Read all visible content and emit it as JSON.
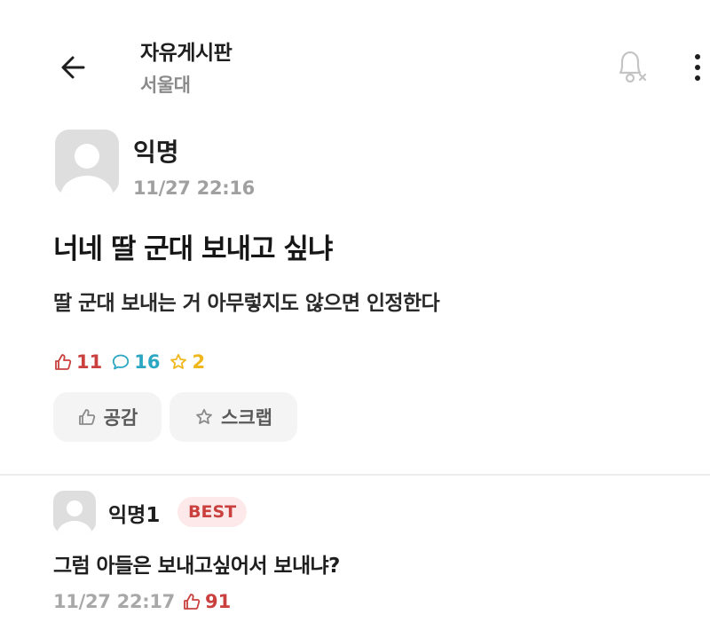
{
  "header": {
    "title": "자유게시판",
    "subtitle": "서울대",
    "back_icon": "arrow-left-icon",
    "bell_icon": "bell-off-icon",
    "more_icon": "more-vertical-icon"
  },
  "post": {
    "author": "익명",
    "date": "11/27 22:16",
    "title": "너네 딸 군대 보내고 싶냐",
    "body": "딸 군대 보내는 거 아무렇지도 않으면 인정한다",
    "stats": {
      "likes": "11",
      "comments": "16",
      "scraps": "2"
    },
    "buttons": {
      "like_label": "공감",
      "scrap_label": "스크랩"
    }
  },
  "comments": [
    {
      "author": "익명1",
      "badge": "BEST",
      "text": "그럼 아들은 보내고싶어서 보내냐?",
      "date": "11/27 22:17",
      "likes": "91"
    }
  ],
  "colors": {
    "like": "#c9403e",
    "comment": "#2ba7c2",
    "scrap": "#f0b71c",
    "meta_gray": "#a0a0a0",
    "badge_bg": "#fde9e9"
  }
}
